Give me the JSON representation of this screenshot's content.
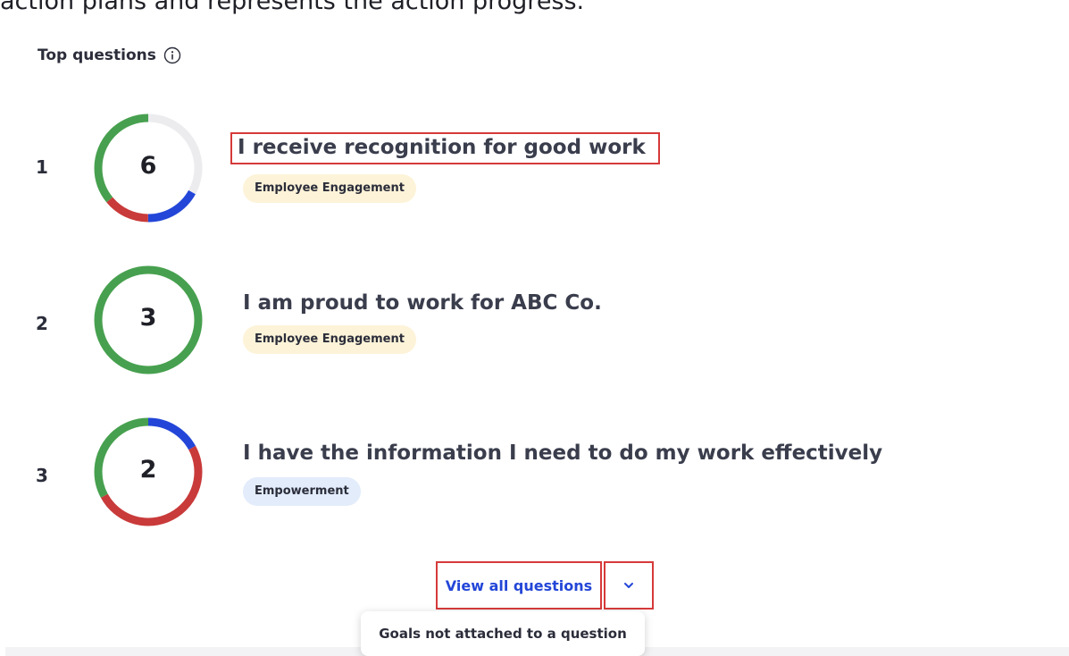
{
  "intro_text": "action plans and represents the action progress.",
  "section": {
    "title": "Top questions",
    "info_icon": "info-circle-icon"
  },
  "questions": [
    {
      "rank": "1",
      "value": "6",
      "text": "I receive recognition for good work",
      "tag": "Employee Engagement",
      "segments": [
        {
          "color": "#ececef",
          "fraction": 0.33
        },
        {
          "color": "#2346d8",
          "fraction": 0.17
        },
        {
          "color": "#c93a3a",
          "fraction": 0.14
        },
        {
          "color": "#47a04f",
          "fraction": 0.36
        }
      ]
    },
    {
      "rank": "2",
      "value": "3",
      "text": "I am proud to work for ABC Co.",
      "tag": "Employee Engagement",
      "segments": [
        {
          "color": "#47a04f",
          "fraction": 1.0
        }
      ]
    },
    {
      "rank": "3",
      "value": "2",
      "text": "I have the information I need to do my work effectively",
      "tag": "Empowerment",
      "segments": [
        {
          "color": "#2346d8",
          "fraction": 0.17
        },
        {
          "color": "#c93a3a",
          "fraction": 0.5
        },
        {
          "color": "#47a04f",
          "fraction": 0.33
        }
      ]
    }
  ],
  "view_all": {
    "label": "View all questions",
    "chevron_icon": "chevron-down-icon"
  },
  "dropdown": {
    "item_label": "Goals not attached to a question"
  },
  "colors": {
    "accent_blue": "#2346d8",
    "green": "#47a04f",
    "red": "#c93a3a",
    "highlight": "#d63a3a"
  }
}
